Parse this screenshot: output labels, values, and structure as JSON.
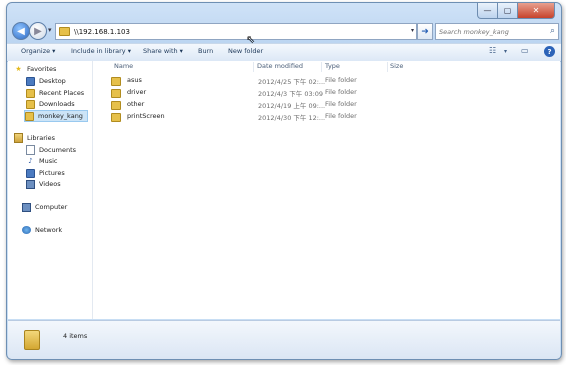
{
  "window": {
    "address": "\\\\192.168.1.103",
    "search_placeholder": "Search monkey_kang",
    "minimize_glyph": "—",
    "maximize_glyph": "▢",
    "close_glyph": "✕"
  },
  "toolbar": {
    "organize": "Organize ▾",
    "include_in_library": "Include in library ▾",
    "share_with": "Share with ▾",
    "burn": "Burn",
    "new_folder": "New folder"
  },
  "nav": {
    "favorites": "Favorites",
    "desktop": "Desktop",
    "recent_places": "Recent Places",
    "downloads": "Downloads",
    "monkey_kang": "monkey_kang",
    "libraries": "Libraries",
    "documents": "Documents",
    "music": "Music",
    "pictures": "Pictures",
    "videos": "Videos",
    "computer": "Computer",
    "network": "Network"
  },
  "columns": {
    "name": "Name",
    "date_modified": "Date modified",
    "type": "Type",
    "size": "Size"
  },
  "files": [
    {
      "name": "asus",
      "date": "2012/4/25 下午 02:...",
      "type": "File folder",
      "size": ""
    },
    {
      "name": "driver",
      "date": "2012/4/3 下午 03:09",
      "type": "File folder",
      "size": ""
    },
    {
      "name": "other",
      "date": "2012/4/19 上午 09:...",
      "type": "File folder",
      "size": ""
    },
    {
      "name": "printScreen",
      "date": "2012/4/30 下午 12:...",
      "type": "File folder",
      "size": ""
    }
  ],
  "status": {
    "item_count": "4 items"
  },
  "colors": {
    "accent": "#2c63b8",
    "folder": "#e6c04a",
    "selection": "#cce4f7"
  }
}
